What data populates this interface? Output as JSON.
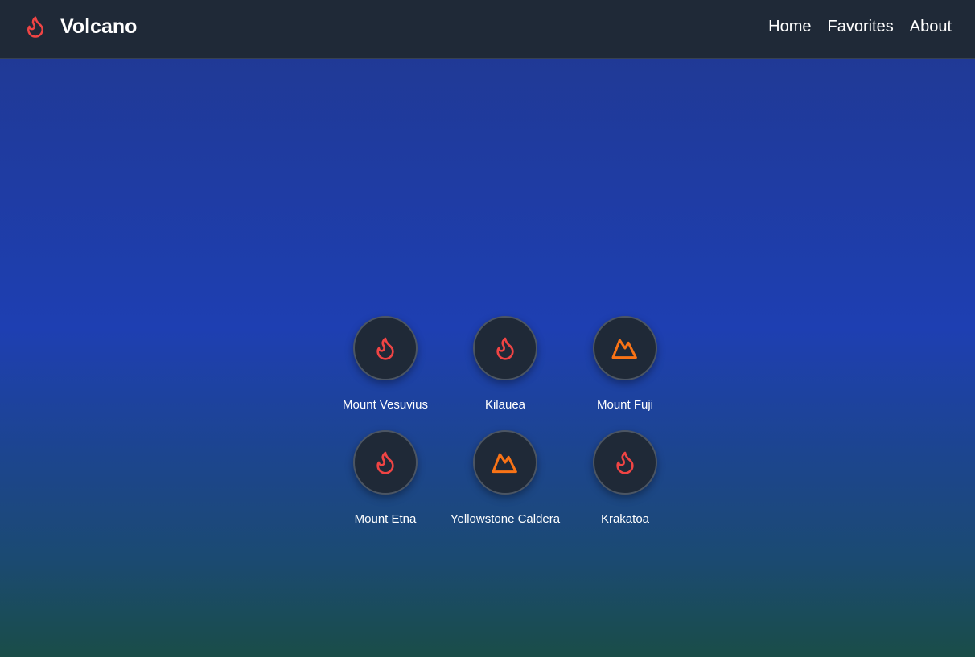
{
  "app": {
    "title": "Volcano",
    "logo_icon": "flame-icon",
    "accent_color": "#ef4444",
    "secondary_accent_color": "#f97316"
  },
  "nav": {
    "links": [
      {
        "label": "Home"
      },
      {
        "label": "Favorites"
      },
      {
        "label": "About"
      }
    ]
  },
  "volcanoes": [
    {
      "name": "Mount Vesuvius",
      "icon": "flame-icon"
    },
    {
      "name": "Kilauea",
      "icon": "flame-icon"
    },
    {
      "name": "Mount Fuji",
      "icon": "mountain-icon"
    },
    {
      "name": "Mount Etna",
      "icon": "flame-icon"
    },
    {
      "name": "Yellowstone Caldera",
      "icon": "mountain-icon"
    },
    {
      "name": "Krakatoa",
      "icon": "flame-icon"
    }
  ]
}
